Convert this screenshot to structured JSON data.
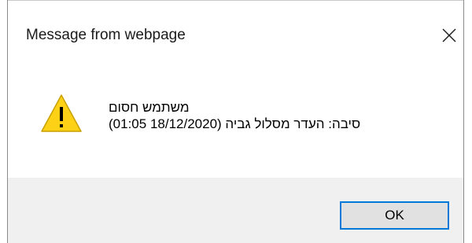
{
  "window": {
    "title": "Message from webpage"
  },
  "icons": {
    "close": "close-icon",
    "warning": "warning-icon"
  },
  "message": {
    "line1": "משתמש חסום",
    "line2": "סיבה: העדר מסלול גביה (18/12/2020 01:05)"
  },
  "buttons": {
    "ok_label": "OK"
  },
  "colors": {
    "accent": "#0078d7",
    "footer_bg": "#f0f0f0",
    "warning_fill": "#fcd116"
  }
}
